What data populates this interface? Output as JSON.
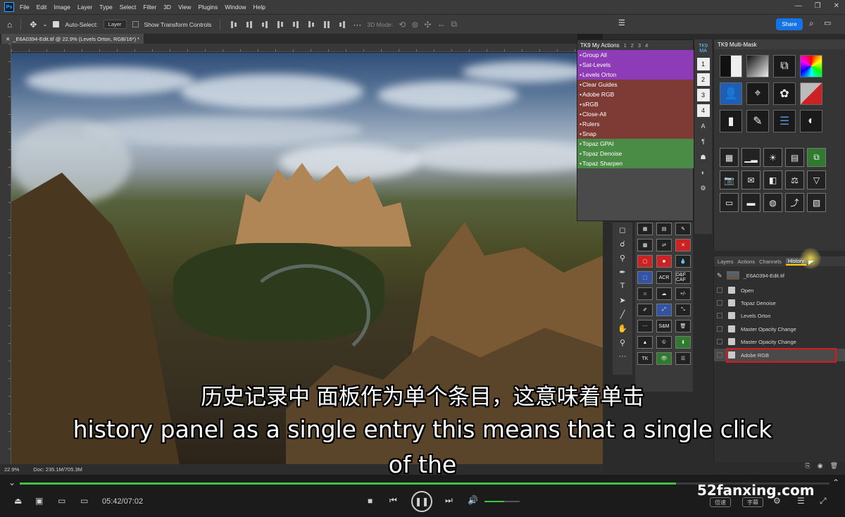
{
  "menubar": {
    "items": [
      "File",
      "Edit",
      "Image",
      "Layer",
      "Type",
      "Select",
      "Filter",
      "3D",
      "View",
      "Plugins",
      "Window",
      "Help"
    ]
  },
  "options": {
    "auto_select_label": "Auto-Select:",
    "auto_select_value": "Layer",
    "transform_label": "Show Transform Controls",
    "mode_3d_label": "3D Mode:",
    "share_label": "Share"
  },
  "document": {
    "tab_title": "_E6A0394-Edit.tif @ 22.9% (Levels Orton, RGB/16*) *",
    "zoom": "22.9%",
    "doc_size": "Doc: 235.1M/705.3M"
  },
  "actions_panel": {
    "title": "TK9 My Actions",
    "tabs": [
      "1",
      "2",
      "3",
      "4"
    ],
    "groups": [
      {
        "color": "#8e3bb8",
        "items": [
          "Group All",
          "Sat-Levels",
          "Levels Orton"
        ]
      },
      {
        "color": "#7e3a34",
        "items": [
          "Clear Guides",
          "Adobe RGB",
          "sRGB",
          "Close-All",
          "Rulers",
          "Snap"
        ]
      },
      {
        "color": "#4a8c45",
        "items": [
          "Topaz GPAI",
          "Topaz Denoise",
          "Topaz Sharpen"
        ]
      }
    ]
  },
  "tk9_strip": [
    "TK9 MA",
    "1",
    "2",
    "3",
    "4"
  ],
  "multimask": {
    "title": "TK9 Multi-Mask"
  },
  "tk_grid_labels": [
    "ACR",
    "D&F CAF",
    "+/-",
    "S&M",
    "TK"
  ],
  "history": {
    "tabs": [
      "Layers",
      "Actions",
      "Channels",
      "History"
    ],
    "snapshot": "_E6A0394-Edit.tif",
    "steps": [
      "Open",
      "Topaz Denoise",
      "Levels Orton",
      "Master Opacity Change",
      "Master Opacity Change",
      "Adobe RGB"
    ]
  },
  "subtitles": {
    "cn": "历史记录中 面板作为单个条目，这意味着单击",
    "en_line1": "history panel as a single entry this means that a single click",
    "en_line2": "of the"
  },
  "player": {
    "time": "05:42/07:02",
    "progress": 0.81,
    "volume": 0.55,
    "watermark": "52fanxing.com",
    "speed_label": "倍速",
    "subtitle_label": "字幕"
  },
  "colors": {
    "share": "#1473e6",
    "progress": "#3ec53e",
    "highlight": "#e0161b"
  }
}
